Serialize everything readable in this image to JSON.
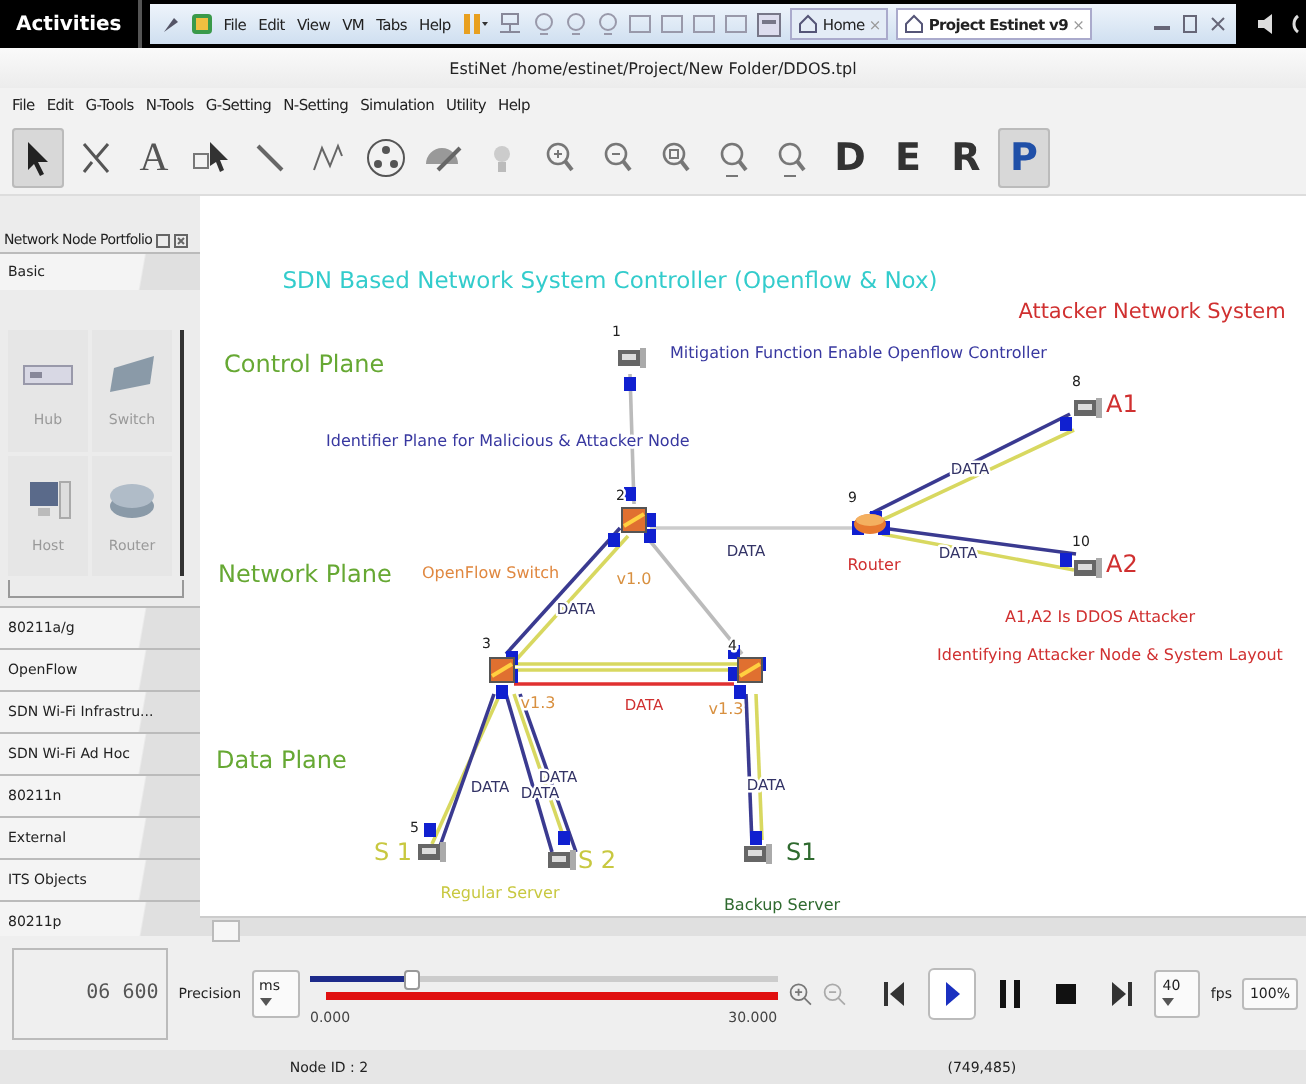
{
  "top_bar": {
    "activities": "Activities",
    "menu": [
      "File",
      "Edit",
      "View",
      "VM",
      "Tabs",
      "Help"
    ],
    "tabs": [
      {
        "label": "Home",
        "close": "×",
        "selected": false
      },
      {
        "label": "Project Estinet v9",
        "close": "×",
        "selected": true
      }
    ]
  },
  "window": {
    "title": "EstiNet  /home/estinet/Project/New Folder/DDOS.tpl"
  },
  "menu": [
    "File",
    "Edit",
    "G-Tools",
    "N-Tools",
    "G-Setting",
    "N-Setting",
    "Simulation",
    "Utility",
    "Help"
  ],
  "toolbar": [
    {
      "kind": "pointer",
      "selected": true
    },
    {
      "kind": "cut",
      "selected": false
    },
    {
      "kind": "text",
      "label": "A",
      "selected": false
    },
    {
      "kind": "select-area",
      "selected": false
    },
    {
      "kind": "link",
      "selected": false
    },
    {
      "kind": "wave",
      "selected": false
    },
    {
      "kind": "group",
      "selected": false
    },
    {
      "kind": "protractor",
      "selected": false
    },
    {
      "kind": "bulb",
      "selected": false
    },
    {
      "kind": "zoom-in",
      "selected": false
    },
    {
      "kind": "zoom-out",
      "selected": false
    },
    {
      "kind": "zoom-fit",
      "selected": false
    },
    {
      "kind": "zoom-all",
      "selected": false
    },
    {
      "kind": "zoom-100",
      "selected": false
    },
    {
      "kind": "letter",
      "label": "D",
      "selected": false
    },
    {
      "kind": "letter",
      "label": "E",
      "selected": false
    },
    {
      "kind": "letter",
      "label": "R",
      "selected": false
    },
    {
      "kind": "letter",
      "label": "P",
      "selected": true
    }
  ],
  "portfolio": {
    "title": "Network Node Portfolio",
    "groups": [
      {
        "label": "Basic",
        "expanded": true,
        "items": [
          {
            "label": "Hub",
            "kind": "hub"
          },
          {
            "label": "Switch",
            "kind": "switch"
          },
          {
            "label": "Host",
            "kind": "host"
          },
          {
            "label": "Router",
            "kind": "router"
          }
        ]
      },
      {
        "label": "80211a/g",
        "expanded": false
      },
      {
        "label": "OpenFlow",
        "expanded": false
      },
      {
        "label": "SDN Wi-Fi Infrastru...",
        "expanded": false
      },
      {
        "label": "SDN Wi-Fi Ad Hoc",
        "expanded": false
      },
      {
        "label": "80211n",
        "expanded": false
      },
      {
        "label": "External",
        "expanded": false
      },
      {
        "label": "ITS Objects",
        "expanded": false
      },
      {
        "label": "80211p",
        "expanded": false
      }
    ]
  },
  "diagram": {
    "labels": [
      {
        "text": "SDN Based Network System Controller (Openflow & Nox)",
        "kind": "title",
        "color": "#33cccc"
      },
      {
        "text": "Attacker Network System",
        "kind": "heading",
        "color": "#d03030"
      },
      {
        "text": "Control Plane",
        "kind": "plane",
        "color": "#66a833"
      },
      {
        "text": "Mitigation Function Enable Openflow Controller",
        "kind": "note",
        "color": "#3838a0"
      },
      {
        "text": "Identifier Plane for Malicious & Attacker Node",
        "kind": "note",
        "color": "#3838a0"
      },
      {
        "text": "Network Plane",
        "kind": "plane",
        "color": "#66a833"
      },
      {
        "text": "OpenFlow Switch",
        "kind": "note",
        "color": "#e08840"
      },
      {
        "text": "v1.0",
        "kind": "version",
        "color": "#d89040"
      },
      {
        "text": "DATA",
        "kind": "link",
        "color": "#333366"
      },
      {
        "text": "Router",
        "kind": "note",
        "color": "#d03030"
      },
      {
        "text": "A1",
        "kind": "node",
        "color": "#d03030"
      },
      {
        "text": "DATA",
        "kind": "link",
        "color": "#333366"
      },
      {
        "text": "A2",
        "kind": "node",
        "color": "#d03030"
      },
      {
        "text": "DATA",
        "kind": "link",
        "color": "#333366"
      },
      {
        "text": "A1,A2 Is DDOS Attacker",
        "kind": "note",
        "color": "#d03030"
      },
      {
        "text": "Identifying Attacker Node & System Layout",
        "kind": "note",
        "color": "#d03030"
      },
      {
        "text": "DATA",
        "kind": "link",
        "color": "#333366"
      },
      {
        "text": "v1.3",
        "kind": "version",
        "color": "#d89040"
      },
      {
        "text": "DATA",
        "kind": "link",
        "color": "#d03030"
      },
      {
        "text": "v1.3",
        "kind": "version",
        "color": "#d89040"
      },
      {
        "text": "Data Plane",
        "kind": "plane",
        "color": "#66a833"
      },
      {
        "text": "DATA",
        "kind": "link",
        "color": "#333366"
      },
      {
        "text": "DATA",
        "kind": "link",
        "color": "#333366"
      },
      {
        "text": "DATA",
        "kind": "link",
        "color": "#333366"
      },
      {
        "text": "DATA",
        "kind": "link",
        "color": "#333366"
      },
      {
        "text": "S 1",
        "kind": "node",
        "color": "#c8c840"
      },
      {
        "text": "S 2",
        "kind": "node",
        "color": "#c8c840"
      },
      {
        "text": "S1",
        "kind": "node",
        "color": "#2f6a2f"
      },
      {
        "text": "Regular Server",
        "kind": "note",
        "color": "#c8c840"
      },
      {
        "text": "Backup Server",
        "kind": "note",
        "color": "#2f6a2f"
      }
    ],
    "nodes": [
      {
        "number": "1",
        "kind": "host"
      },
      {
        "number": "2",
        "kind": "switch"
      },
      {
        "number": "3",
        "kind": "switch"
      },
      {
        "number": "4",
        "kind": "switch"
      },
      {
        "number": "5",
        "kind": "host"
      },
      {
        "kind": "host"
      },
      {
        "kind": "host"
      },
      {
        "number": "8",
        "kind": "host"
      },
      {
        "number": "9",
        "kind": "router"
      },
      {
        "number": "10",
        "kind": "host"
      }
    ]
  },
  "playback": {
    "time": "06 600",
    "precision_label": "Precision",
    "precision": "ms",
    "level": 0.22,
    "start": "0.000",
    "end": "30.000",
    "controls": [
      {
        "kind": "first",
        "selected": false
      },
      {
        "kind": "play",
        "selected": true
      },
      {
        "kind": "pause",
        "selected": false
      },
      {
        "kind": "stop",
        "selected": false
      },
      {
        "kind": "last",
        "selected": false
      }
    ],
    "fps": "40",
    "fps_label": "fps",
    "zoom": "100%"
  },
  "status_bar": {
    "node": "Node ID : 2",
    "coords": "(749,485)"
  }
}
